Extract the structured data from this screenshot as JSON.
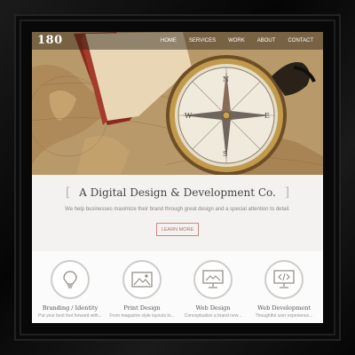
{
  "header": {
    "logo": "180",
    "nav": [
      "HOME",
      "SERVICES",
      "WORK",
      "ABOUT",
      "CONTACT"
    ]
  },
  "intro": {
    "headline": "A Digital Design & Development Co.",
    "bracket_left": "[",
    "bracket_right": "]",
    "subtext": "We help businesses maximize their brand through great design and a special attention to detail.",
    "button": "LEARN MORE"
  },
  "services": [
    {
      "title": "Branding / Identity",
      "desc": "Put your best foot forward with...",
      "icon": "lightbulb-icon"
    },
    {
      "title": "Print Design",
      "desc": "From magazine style layouts to...",
      "icon": "image-icon"
    },
    {
      "title": "Web Design",
      "desc": "Conceptualize a brand new...",
      "icon": "monitor-icon"
    },
    {
      "title": "Web Development",
      "desc": "Thoughtful user experience...",
      "icon": "code-icon"
    }
  ],
  "colors": {
    "accent": "#c88c7d",
    "frame": "#0c0c0c",
    "hero": "#a98559"
  }
}
